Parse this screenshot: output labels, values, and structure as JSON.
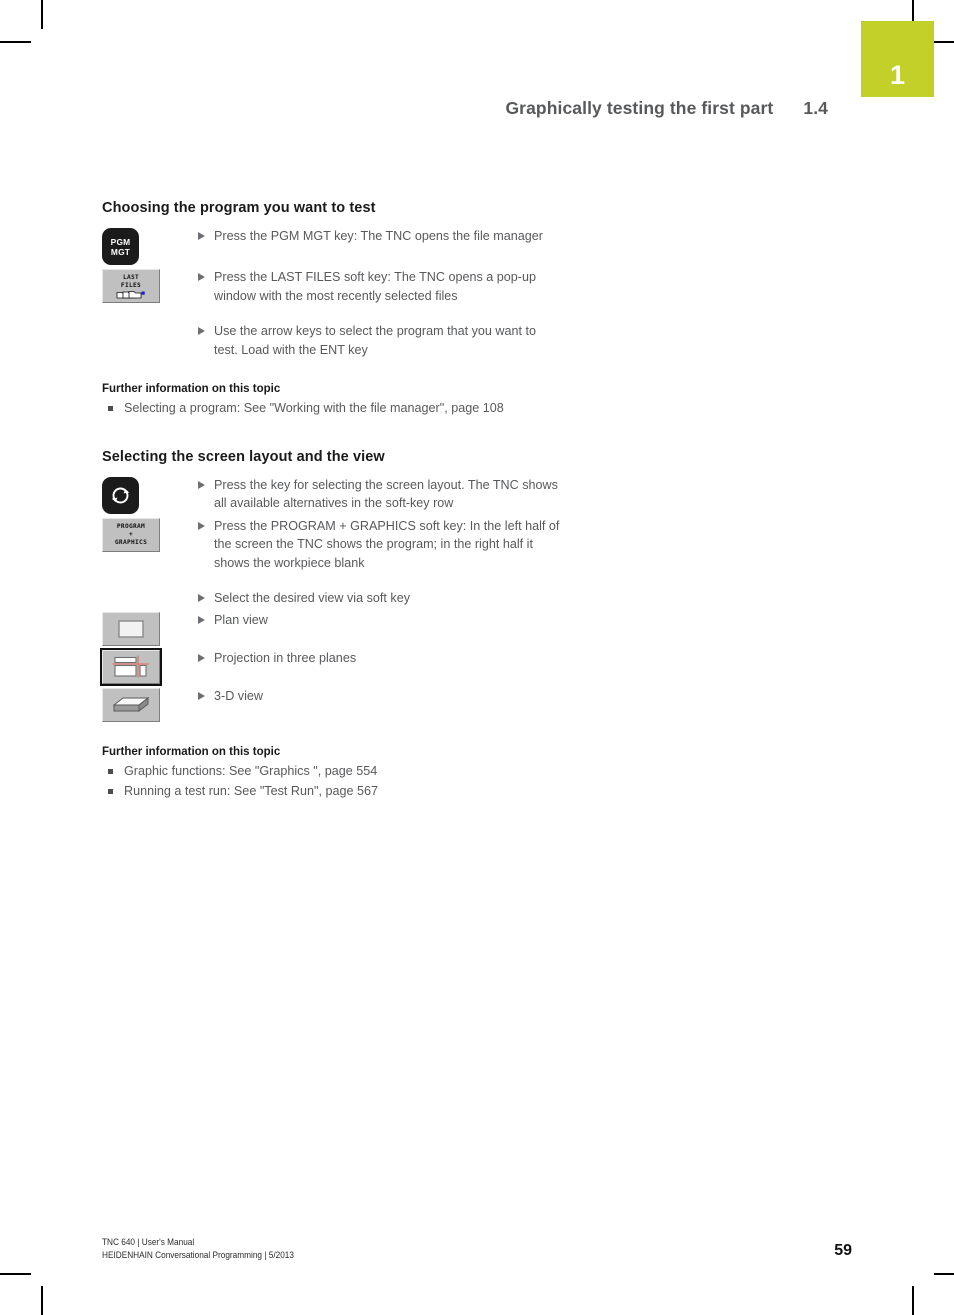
{
  "page": {
    "chapter_tab": "1",
    "running_head": "Graphically testing the first part",
    "running_head_number": "1.4",
    "page_number": "59",
    "accent_color": "#c3d02a",
    "text_color": "#58595b"
  },
  "sections": [
    {
      "title": "Choosing the program you want to test",
      "steps": [
        {
          "key": {
            "type": "hardkey",
            "name": "pgm-mgt-key",
            "line1": "PGM",
            "line2": "MGT"
          },
          "text": "Press the PGM MGT key: The TNC opens the file manager"
        },
        {
          "key": {
            "type": "softkey",
            "name": "last-files-softkey",
            "line1": "LAST",
            "line2": "FILES",
            "icon": "files-icon"
          },
          "text": "Press the LAST FILES soft key: The TNC opens a pop-up window with the most recently selected files"
        },
        {
          "key": null,
          "text": "Use the arrow keys to select the program that you want to test. Load with the ENT key"
        }
      ],
      "further_title": "Further information on this topic",
      "further_items": [
        "Selecting a program: See \"Working with the file manager\", page 108"
      ]
    },
    {
      "title": "Selecting the screen layout and the view",
      "steps": [
        {
          "key": {
            "type": "hardkey",
            "name": "screen-layout-key",
            "icon": "circular-arrows-icon"
          },
          "text": "Press the key for selecting the screen layout. The TNC shows all available alternatives in the soft-key row"
        },
        {
          "key": {
            "type": "softkey",
            "name": "program-graphics-softkey",
            "line1": "PROGRAM",
            "line2": "+",
            "line3": "GRAPHICS"
          },
          "text": "Press the PROGRAM + GRAPHICS soft key: In the left half of the screen the TNC shows the program; in the right half it shows the workpiece blank"
        },
        {
          "key": null,
          "text": "Select the desired view via soft key"
        },
        {
          "key": {
            "type": "softkey",
            "name": "plan-view-softkey",
            "icon": "plan-view-icon"
          },
          "text": "Plan view"
        },
        {
          "key": {
            "type": "softkey",
            "name": "three-planes-softkey",
            "icon": "three-planes-icon",
            "active": true
          },
          "text": "Projection in three planes"
        },
        {
          "key": {
            "type": "softkey",
            "name": "three-d-view-softkey",
            "icon": "three-d-box-icon"
          },
          "text": "3-D view"
        }
      ],
      "further_title": "Further information on this topic",
      "further_items": [
        "Graphic functions: See \"Graphics \", page 554",
        "Running a test run: See \"Test Run\", page 567"
      ]
    }
  ],
  "footer": {
    "line1": "TNC 640 | User's Manual",
    "line2": "HEIDENHAIN Conversational Programming | 5/2013"
  }
}
